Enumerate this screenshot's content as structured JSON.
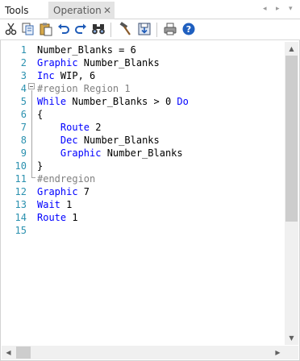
{
  "tabs": {
    "tools": "Tools",
    "operation": "Operation",
    "close_glyph": "✕",
    "nav_left": "◂",
    "nav_right": "▸",
    "nav_menu": "▾"
  },
  "toolbar": {
    "icons": [
      "cut-icon",
      "copy-icon",
      "paste-icon",
      "undo-icon",
      "redo-icon",
      "find-icon",
      "build-icon",
      "save-icon",
      "print-icon",
      "help-icon"
    ]
  },
  "editor": {
    "lines": [
      {
        "n": "1",
        "segs": [
          {
            "t": "Number_Blanks = 6"
          }
        ]
      },
      {
        "n": "2",
        "segs": [
          {
            "t": "Graphic",
            "c": "kw"
          },
          {
            "t": " Number_Blanks"
          }
        ]
      },
      {
        "n": "3",
        "segs": [
          {
            "t": "Inc",
            "c": "kw"
          },
          {
            "t": " WIP, 6"
          }
        ]
      },
      {
        "n": "4",
        "segs": [
          {
            "t": "#region Region 1",
            "c": "cm"
          }
        ]
      },
      {
        "n": "5",
        "segs": [
          {
            "t": "While",
            "c": "kw"
          },
          {
            "t": " Number_Blanks > 0 "
          },
          {
            "t": "Do",
            "c": "kw"
          }
        ]
      },
      {
        "n": "6",
        "segs": [
          {
            "t": "{"
          }
        ]
      },
      {
        "n": "7",
        "segs": [
          {
            "t": "    "
          },
          {
            "t": "Route",
            "c": "kw"
          },
          {
            "t": " 2"
          }
        ]
      },
      {
        "n": "8",
        "segs": [
          {
            "t": "    "
          },
          {
            "t": "Dec",
            "c": "kw"
          },
          {
            "t": " Number_Blanks"
          }
        ]
      },
      {
        "n": "9",
        "segs": [
          {
            "t": "    "
          },
          {
            "t": "Graphic",
            "c": "kw"
          },
          {
            "t": " Number_Blanks"
          }
        ]
      },
      {
        "n": "10",
        "segs": [
          {
            "t": "}"
          }
        ]
      },
      {
        "n": "11",
        "segs": [
          {
            "t": "#endregion",
            "c": "cm"
          }
        ]
      },
      {
        "n": "12",
        "segs": [
          {
            "t": "Graphic",
            "c": "kw"
          },
          {
            "t": " 7"
          }
        ]
      },
      {
        "n": "13",
        "segs": [
          {
            "t": "Wait",
            "c": "kw"
          },
          {
            "t": " 1"
          }
        ]
      },
      {
        "n": "14",
        "segs": [
          {
            "t": "Route",
            "c": "kw"
          },
          {
            "t": " 1"
          }
        ]
      },
      {
        "n": "15",
        "segs": [
          {
            "t": ""
          }
        ]
      }
    ],
    "region_fold": {
      "start_line": "4",
      "end_line": "11"
    }
  },
  "colors": {
    "keyword": "#0000ff",
    "comment": "#808080",
    "line_number": "#2b91af",
    "text": "#000000"
  }
}
